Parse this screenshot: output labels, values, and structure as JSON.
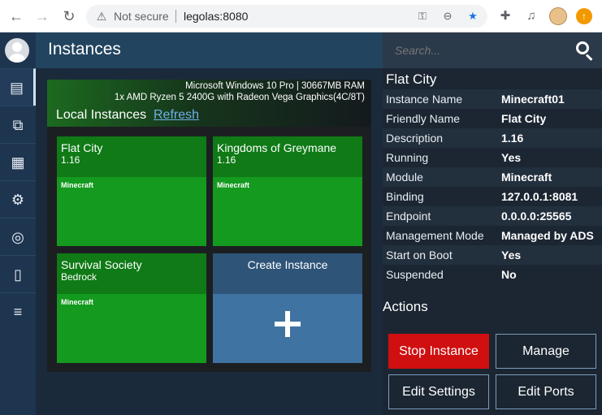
{
  "browser": {
    "security_label": "Not secure",
    "url": "legolas:8080"
  },
  "header": {
    "title": "Instances"
  },
  "sidebar": {
    "items": [
      {
        "name": "dashboard-icon",
        "glyph": "▤"
      },
      {
        "name": "console-icon",
        "glyph": "⧉"
      },
      {
        "name": "grid-icon",
        "glyph": "▦"
      },
      {
        "name": "settings-icon",
        "glyph": "⚙"
      },
      {
        "name": "support-icon",
        "glyph": "◎"
      },
      {
        "name": "file-icon",
        "glyph": "▯"
      },
      {
        "name": "database-icon",
        "glyph": "≡"
      }
    ]
  },
  "system": {
    "line1": "Microsoft Windows 10 Pro | 30667MB RAM",
    "line2": "1x AMD Ryzen 5 2400G with Radeon Vega Graphics(4C/8T)"
  },
  "local": {
    "label": "Local Instances",
    "refresh": "Refresh"
  },
  "instances": [
    {
      "name": "Flat City",
      "version": "1.16",
      "module": "Minecraft"
    },
    {
      "name": "Kingdoms of Greymane",
      "version": "1.16",
      "module": "Minecraft"
    },
    {
      "name": "Survival Society",
      "version": "Bedrock",
      "module": "Minecraft"
    }
  ],
  "create": {
    "label": "Create Instance",
    "glyph": "+"
  },
  "search": {
    "placeholder": "Search..."
  },
  "details": {
    "title": "Flat City",
    "rows": [
      {
        "key": "Instance Name",
        "value": "Minecraft01"
      },
      {
        "key": "Friendly Name",
        "value": "Flat City"
      },
      {
        "key": "Description",
        "value": "1.16"
      },
      {
        "key": "Running",
        "value": "Yes"
      },
      {
        "key": "Module",
        "value": "Minecraft"
      },
      {
        "key": "Binding",
        "value": "127.0.0.1:8081"
      },
      {
        "key": "Endpoint",
        "value": "0.0.0.0:25565"
      },
      {
        "key": "Management Mode",
        "value": "Managed by ADS"
      },
      {
        "key": "Start on Boot",
        "value": "Yes"
      },
      {
        "key": "Suspended",
        "value": "No"
      }
    ]
  },
  "actions": {
    "label": "Actions",
    "stop": "Stop Instance",
    "manage": "Manage",
    "edit_settings": "Edit Settings",
    "edit_ports": "Edit Ports"
  },
  "colors": {
    "tile_green": "#149a1f",
    "create_blue": "#3f73a2",
    "stop_red": "#d00f10"
  }
}
